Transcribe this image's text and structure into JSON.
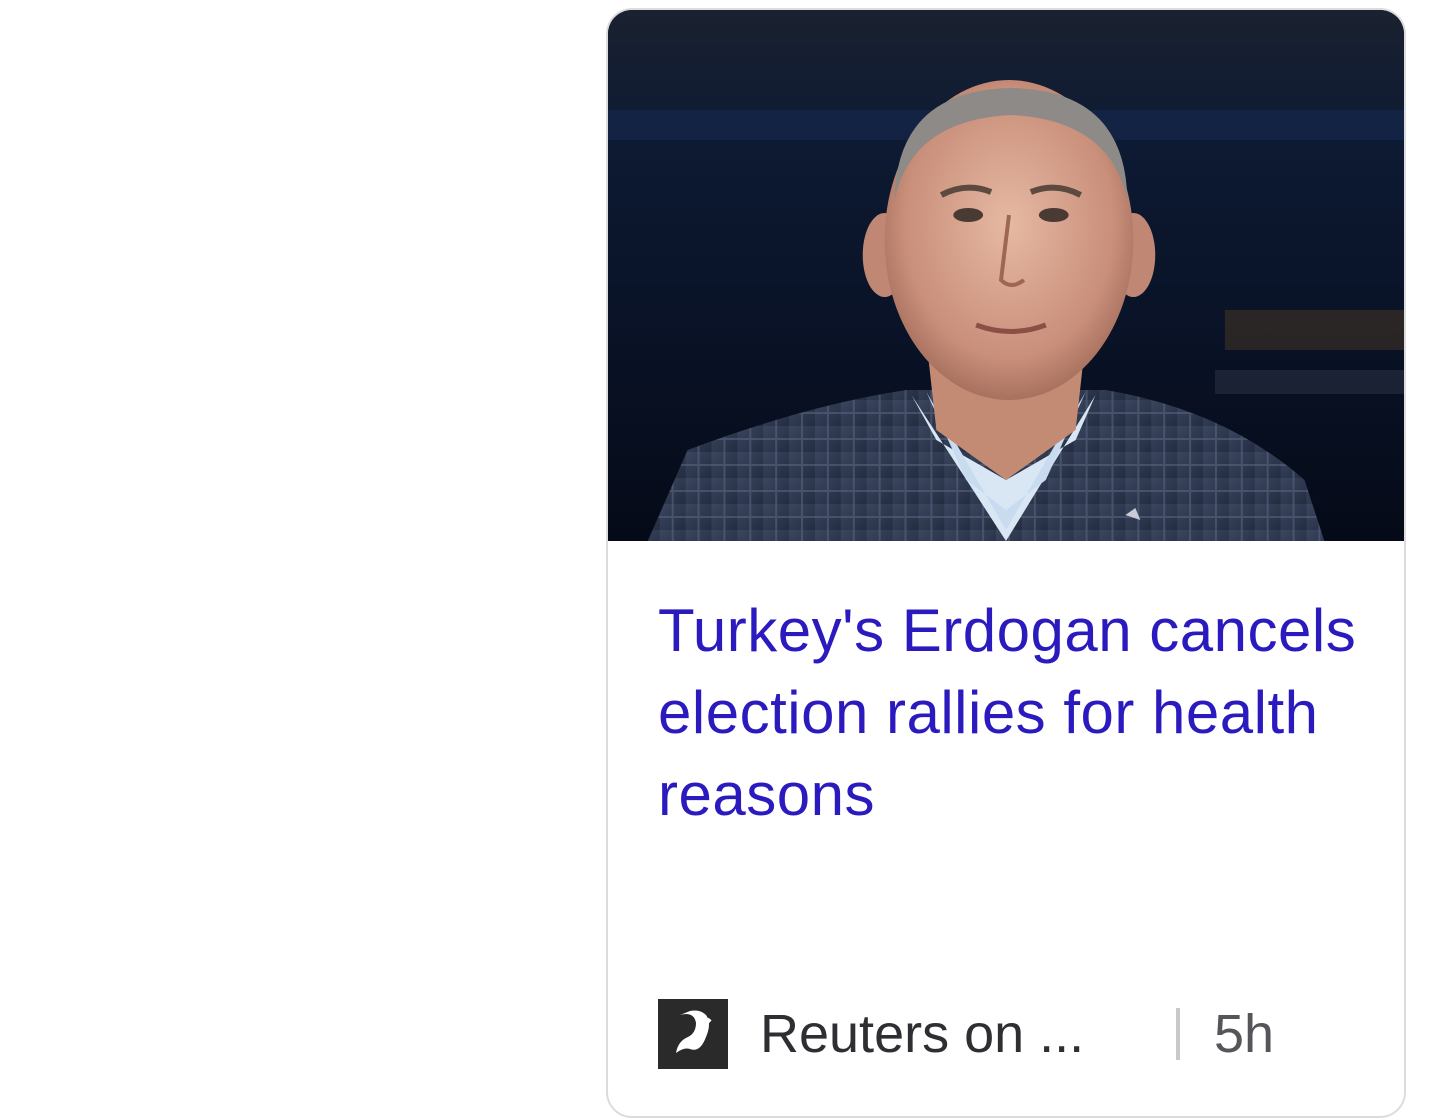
{
  "article": {
    "headline": "Turkey's Erdogan cancels election rallies for health reasons",
    "image_alt": "Recep Tayyip Erdogan portrait",
    "source_name": "Reuters on ...",
    "source_icon": "publisher-logo-icon",
    "timestamp": "5h"
  },
  "colors": {
    "headline": "#2b1bbf",
    "meta_text": "#2f2f33",
    "card_border": "#dcdcde"
  }
}
